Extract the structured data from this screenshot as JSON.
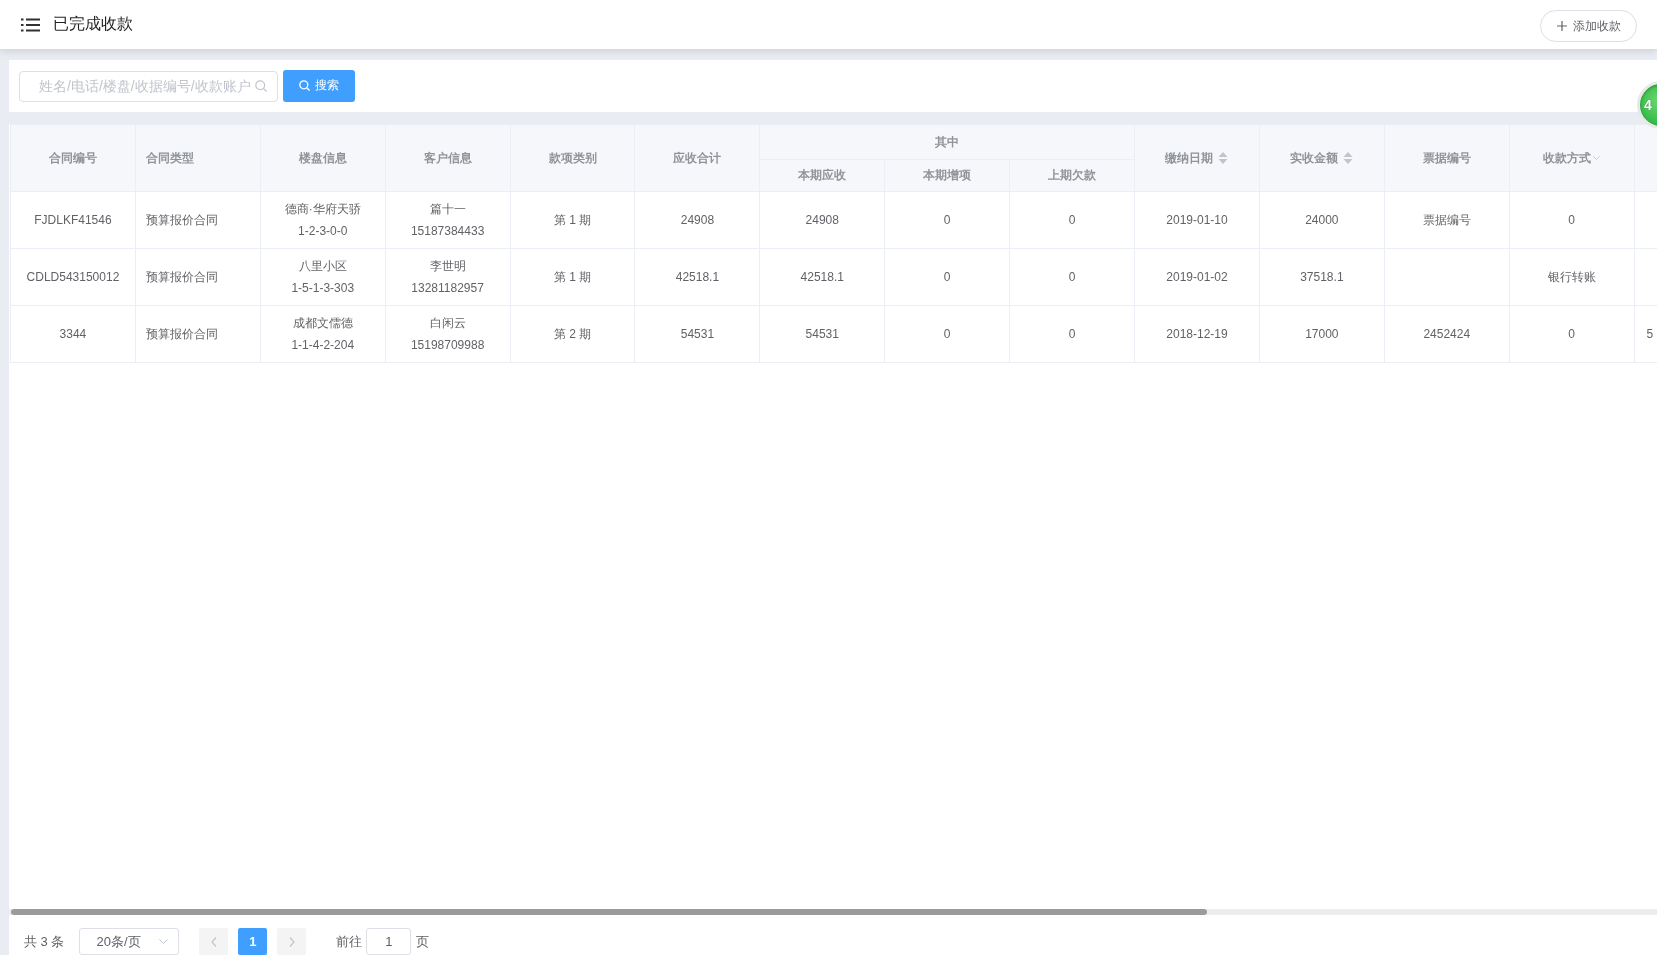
{
  "topbar": {
    "title": "已完成收款",
    "add_button": "添加收款"
  },
  "search": {
    "placeholder": "姓名/电话/楼盘/收据编号/收款账户",
    "button": "搜索"
  },
  "table": {
    "columns": [
      {
        "label": "合同编号",
        "kind": "plain"
      },
      {
        "label": "合同类型",
        "kind": "plain"
      },
      {
        "label": "楼盘信息",
        "kind": "plain"
      },
      {
        "label": "客户信息",
        "kind": "plain"
      },
      {
        "label": "款项类别",
        "kind": "plain"
      },
      {
        "label": "应收合计",
        "kind": "plain"
      },
      {
        "label": "其中",
        "kind": "group",
        "colspan": 3,
        "children": [
          {
            "label": "本期应收"
          },
          {
            "label": "本期增项"
          },
          {
            "label": "上期欠款"
          }
        ]
      },
      {
        "label": "缴纳日期",
        "kind": "sortable"
      },
      {
        "label": "实收金额",
        "kind": "sortable"
      },
      {
        "label": "票据编号",
        "kind": "plain"
      },
      {
        "label": "收款方式",
        "kind": "filter"
      }
    ],
    "rows": [
      {
        "cells": [
          "FJDLKF41546",
          "预算报价合同",
          [
            "德商·华府天骄",
            "1-2-3-0-0"
          ],
          [
            "篇十一",
            "15187384433"
          ],
          "第 1 期",
          "24908",
          "24908",
          "0",
          "0",
          "2019-01-10",
          "24000",
          "票据编号",
          "0"
        ]
      },
      {
        "cells": [
          "CDLD543150012",
          "预算报价合同",
          [
            "八里小区",
            "1-5-1-3-303"
          ],
          [
            "李世明",
            "13281182957"
          ],
          "第 1 期",
          "42518.1",
          "42518.1",
          "0",
          "0",
          "2019-01-02",
          "37518.1",
          null,
          "银行转账"
        ]
      },
      {
        "cells": [
          "3344",
          "预算报价合同",
          [
            "成都文儒德",
            "1-1-4-2-204"
          ],
          [
            "白闲云",
            "15198709988"
          ],
          "第 2 期",
          "54531",
          "54531",
          "0",
          "0",
          "2018-12-19",
          "17000",
          "2452424",
          "0",
          "5"
        ]
      }
    ]
  },
  "pagination": {
    "total": "共 3 条",
    "page_size": "20条/页",
    "prev": {
      "disabled": true
    },
    "pages": [
      {
        "label": "1",
        "selected": true
      }
    ],
    "next": {
      "disabled": true
    },
    "goto_label": "前往",
    "goto_value": "1",
    "goto_suffix": "页"
  },
  "floating_badge": {
    "text": "4"
  }
}
